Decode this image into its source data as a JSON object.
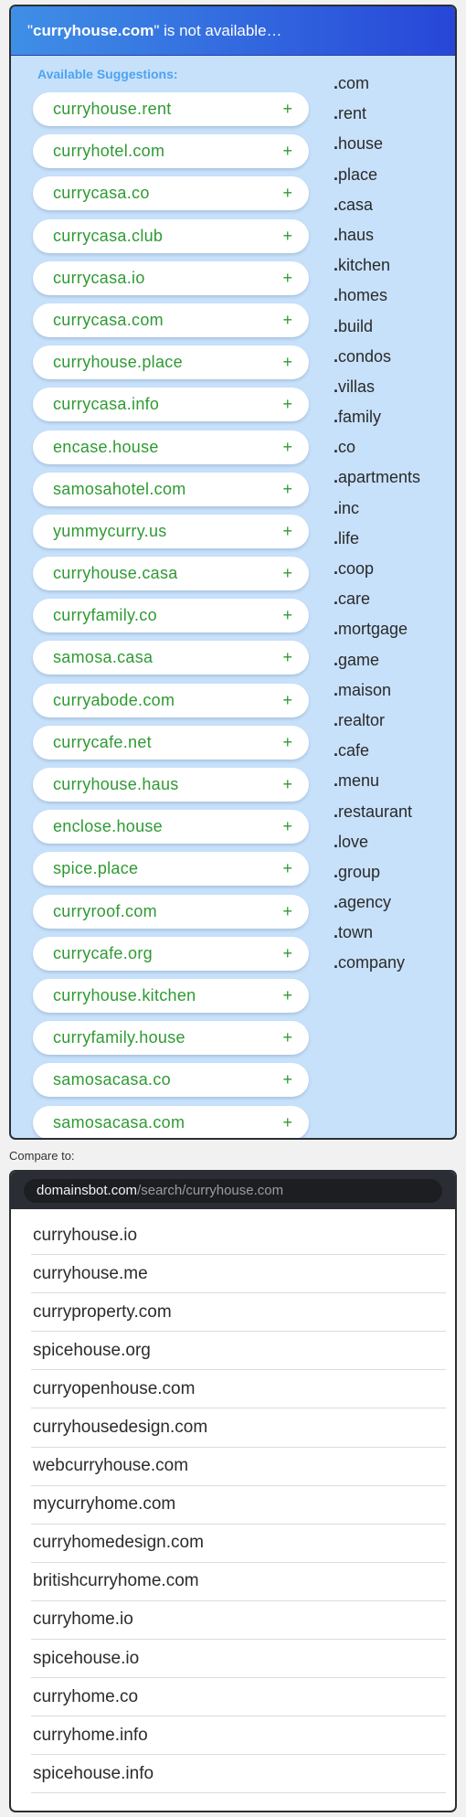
{
  "header": {
    "quote_open": "\"",
    "domain": "curryhouse.com",
    "message": "\" is not available…"
  },
  "suggestions": {
    "title": "Available Suggestions:",
    "plus": "+",
    "items": [
      "curryhouse.rent",
      "curryhotel.com",
      "currycasa.co",
      "currycasa.club",
      "currycasa.io",
      "currycasa.com",
      "curryhouse.place",
      "currycasa.info",
      "encase.house",
      "samosahotel.com",
      "yummycurry.us",
      "curryhouse.casa",
      "curryfamily.co",
      "samosa.casa",
      "curryabode.com",
      "currycafe.net",
      "curryhouse.haus",
      "enclose.house",
      "spice.place",
      "curryroof.com",
      "currycafe.org",
      "curryhouse.kitchen",
      "curryfamily.house",
      "samosacasa.co",
      "samosacasa.com"
    ]
  },
  "tlds": {
    "dot": ".",
    "items": [
      "com",
      "rent",
      "house",
      "place",
      "casa",
      "haus",
      "kitchen",
      "homes",
      "build",
      "condos",
      "villas",
      "family",
      "co",
      "apartments",
      "inc",
      "life",
      "coop",
      "care",
      "mortgage",
      "game",
      "maison",
      "realtor",
      "cafe",
      "menu",
      "restaurant",
      "love",
      "group",
      "agency",
      "town",
      "company"
    ]
  },
  "compare": {
    "label": "Compare to:",
    "url_domain": "domainsbot.com",
    "url_path": "/search/curryhouse.com",
    "results": [
      "curryhouse.io",
      "curryhouse.me",
      "curryproperty.com",
      "spicehouse.org",
      "curryopenhouse.com",
      "curryhousedesign.com",
      "webcurryhouse.com",
      "mycurryhome.com",
      "curryhomedesign.com",
      "britishcurryhome.com",
      "curryhome.io",
      "spicehouse.io",
      "curryhome.co",
      "curryhome.info",
      "spicehouse.info"
    ]
  },
  "colors": {
    "panel_bg": "#c7e1fb",
    "header_gradient_start": "#3f8fe6",
    "header_gradient_end": "#2746d8",
    "suggestion_text": "#2f9a33",
    "suggestion_title": "#4da3f2"
  }
}
